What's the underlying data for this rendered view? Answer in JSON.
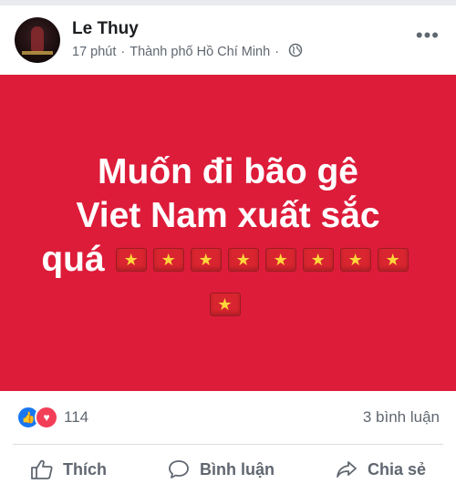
{
  "post": {
    "author": "Le Thuy",
    "time": "17 phút",
    "separator": "·",
    "location": "Thành phố Hồ Chí Minh",
    "separator2": "·",
    "privacy_icon": "globe-icon",
    "menu_icon": "more-options-icon"
  },
  "banner": {
    "background": "#dd1c3a",
    "line1": "Muốn đi bão gê",
    "line2": "Viet Nam xuất sắc",
    "line3_word": "quá",
    "flag_icon": "vietnam-flag-icon",
    "flag_star": "★"
  },
  "reactions": {
    "count": "114",
    "comments": "3 bình luận",
    "like_glyph": "👍",
    "love_glyph": "♥"
  },
  "actions": {
    "like": "Thích",
    "comment": "Bình luận",
    "share": "Chia sẻ"
  }
}
